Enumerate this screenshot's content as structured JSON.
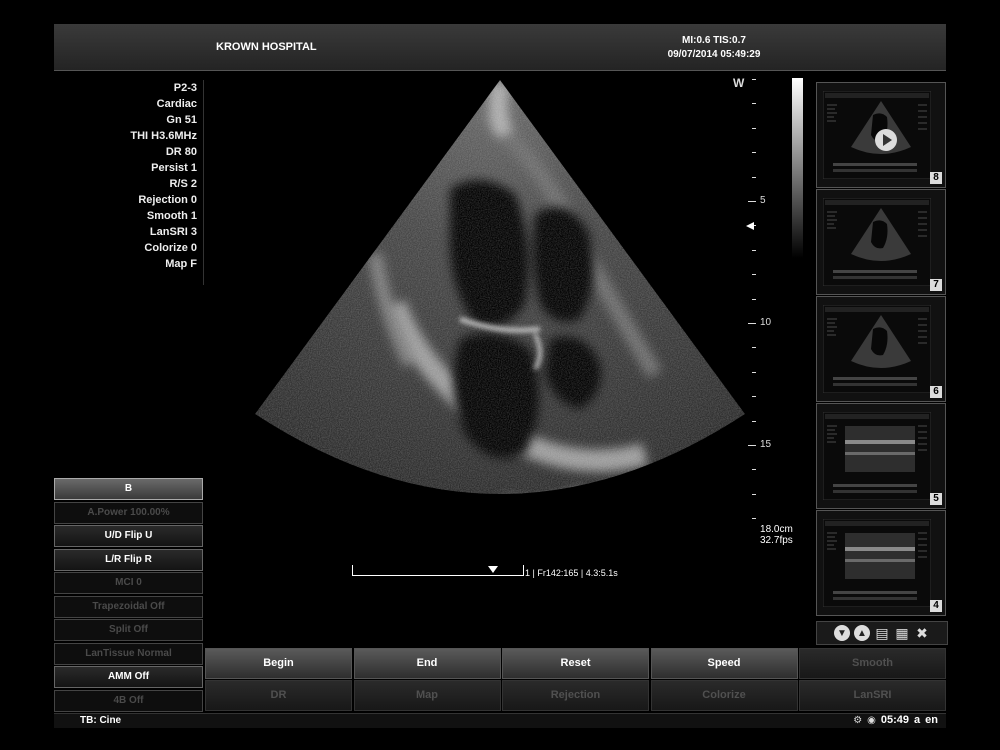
{
  "header": {
    "hospital": "KROWN HOSPITAL",
    "mi_tis": "MI:0.6  TIS:0.7",
    "datetime": "09/07/2014 05:49:29"
  },
  "params": [
    "P2-3",
    "Cardiac",
    "Gn 51",
    "THI H3.6MHz",
    "DR 80",
    "Persist 1",
    "R/S 2",
    "Rejection 0",
    "Smooth 1",
    "LanSRI 3",
    "Colorize 0",
    "Map F"
  ],
  "depth_scale": {
    "top_marker": "W",
    "labels": [
      {
        "text": "5"
      },
      {
        "text": "10"
      },
      {
        "text": "15"
      }
    ],
    "depth": "18.0cm",
    "fps": "32.7fps"
  },
  "cine": {
    "info": "1 | Fr142:165 | 4.3:5.1s"
  },
  "thumbnails": [
    {
      "num": "8",
      "has_play": true
    },
    {
      "num": "7",
      "has_play": false
    },
    {
      "num": "6",
      "has_play": false
    },
    {
      "num": "5",
      "has_play": false
    },
    {
      "num": "4",
      "has_play": false
    }
  ],
  "thumb_tools": [
    {
      "name": "scroll-down-icon",
      "glyph": "▼"
    },
    {
      "name": "scroll-up-icon",
      "glyph": "▲"
    },
    {
      "name": "save-icon",
      "glyph": "▤"
    },
    {
      "name": "export-icon",
      "glyph": "▦"
    },
    {
      "name": "delete-icon",
      "glyph": "✖"
    }
  ],
  "mode_buttons": [
    {
      "label": "B",
      "state": "active"
    },
    {
      "label": "A.Power 100.00%",
      "state": "off"
    },
    {
      "label": "U/D Flip  U",
      "state": "on"
    },
    {
      "label": "L/R Flip  R",
      "state": "on"
    },
    {
      "label": "MCI 0",
      "state": "off"
    },
    {
      "label": "Trapezoidal  Off",
      "state": "off"
    },
    {
      "label": "Split  Off",
      "state": "off"
    },
    {
      "label": "LanTissue Normal",
      "state": "off"
    },
    {
      "label": "AMM  Off",
      "state": "on"
    },
    {
      "label": "4B  Off",
      "state": "off"
    }
  ],
  "softkeys": {
    "row1": [
      {
        "label": "Begin",
        "state": "on"
      },
      {
        "label": "End",
        "state": "on"
      },
      {
        "label": "Reset",
        "state": "on"
      },
      {
        "label": "Speed",
        "state": "on"
      },
      {
        "label": "Smooth",
        "state": "off"
      }
    ],
    "row2": [
      {
        "label": "DR",
        "state": "off"
      },
      {
        "label": "Map",
        "state": "off"
      },
      {
        "label": "Rejection",
        "state": "off"
      },
      {
        "label": "Colorize",
        "state": "off"
      },
      {
        "label": "LanSRI",
        "state": "off"
      }
    ]
  },
  "status": {
    "tb": "TB: Cine",
    "time": "05:49",
    "lang_a": "a",
    "lang_en": "en"
  }
}
